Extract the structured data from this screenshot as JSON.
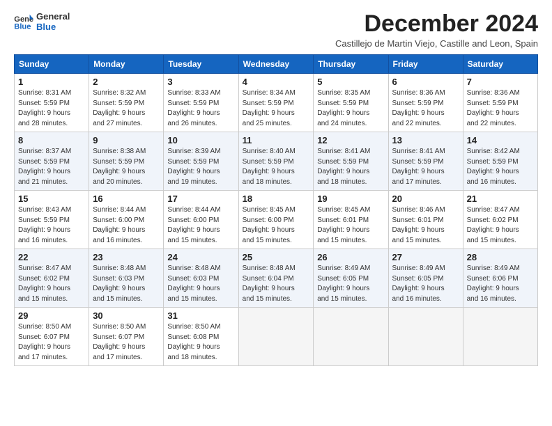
{
  "logo": {
    "line1": "General",
    "line2": "Blue"
  },
  "title": "December 2024",
  "subtitle": "Castillejo de Martin Viejo, Castille and Leon, Spain",
  "days_header": [
    "Sunday",
    "Monday",
    "Tuesday",
    "Wednesday",
    "Thursday",
    "Friday",
    "Saturday"
  ],
  "weeks": [
    [
      {
        "num": "1",
        "info": "Sunrise: 8:31 AM\nSunset: 5:59 PM\nDaylight: 9 hours\nand 28 minutes."
      },
      {
        "num": "2",
        "info": "Sunrise: 8:32 AM\nSunset: 5:59 PM\nDaylight: 9 hours\nand 27 minutes."
      },
      {
        "num": "3",
        "info": "Sunrise: 8:33 AM\nSunset: 5:59 PM\nDaylight: 9 hours\nand 26 minutes."
      },
      {
        "num": "4",
        "info": "Sunrise: 8:34 AM\nSunset: 5:59 PM\nDaylight: 9 hours\nand 25 minutes."
      },
      {
        "num": "5",
        "info": "Sunrise: 8:35 AM\nSunset: 5:59 PM\nDaylight: 9 hours\nand 24 minutes."
      },
      {
        "num": "6",
        "info": "Sunrise: 8:36 AM\nSunset: 5:59 PM\nDaylight: 9 hours\nand 22 minutes."
      },
      {
        "num": "7",
        "info": "Sunrise: 8:36 AM\nSunset: 5:59 PM\nDaylight: 9 hours\nand 22 minutes."
      }
    ],
    [
      {
        "num": "8",
        "info": "Sunrise: 8:37 AM\nSunset: 5:59 PM\nDaylight: 9 hours\nand 21 minutes."
      },
      {
        "num": "9",
        "info": "Sunrise: 8:38 AM\nSunset: 5:59 PM\nDaylight: 9 hours\nand 20 minutes."
      },
      {
        "num": "10",
        "info": "Sunrise: 8:39 AM\nSunset: 5:59 PM\nDaylight: 9 hours\nand 19 minutes."
      },
      {
        "num": "11",
        "info": "Sunrise: 8:40 AM\nSunset: 5:59 PM\nDaylight: 9 hours\nand 18 minutes."
      },
      {
        "num": "12",
        "info": "Sunrise: 8:41 AM\nSunset: 5:59 PM\nDaylight: 9 hours\nand 18 minutes."
      },
      {
        "num": "13",
        "info": "Sunrise: 8:41 AM\nSunset: 5:59 PM\nDaylight: 9 hours\nand 17 minutes."
      },
      {
        "num": "14",
        "info": "Sunrise: 8:42 AM\nSunset: 5:59 PM\nDaylight: 9 hours\nand 16 minutes."
      }
    ],
    [
      {
        "num": "15",
        "info": "Sunrise: 8:43 AM\nSunset: 5:59 PM\nDaylight: 9 hours\nand 16 minutes."
      },
      {
        "num": "16",
        "info": "Sunrise: 8:44 AM\nSunset: 6:00 PM\nDaylight: 9 hours\nand 16 minutes."
      },
      {
        "num": "17",
        "info": "Sunrise: 8:44 AM\nSunset: 6:00 PM\nDaylight: 9 hours\nand 15 minutes."
      },
      {
        "num": "18",
        "info": "Sunrise: 8:45 AM\nSunset: 6:00 PM\nDaylight: 9 hours\nand 15 minutes."
      },
      {
        "num": "19",
        "info": "Sunrise: 8:45 AM\nSunset: 6:01 PM\nDaylight: 9 hours\nand 15 minutes."
      },
      {
        "num": "20",
        "info": "Sunrise: 8:46 AM\nSunset: 6:01 PM\nDaylight: 9 hours\nand 15 minutes."
      },
      {
        "num": "21",
        "info": "Sunrise: 8:47 AM\nSunset: 6:02 PM\nDaylight: 9 hours\nand 15 minutes."
      }
    ],
    [
      {
        "num": "22",
        "info": "Sunrise: 8:47 AM\nSunset: 6:02 PM\nDaylight: 9 hours\nand 15 minutes."
      },
      {
        "num": "23",
        "info": "Sunrise: 8:48 AM\nSunset: 6:03 PM\nDaylight: 9 hours\nand 15 minutes."
      },
      {
        "num": "24",
        "info": "Sunrise: 8:48 AM\nSunset: 6:03 PM\nDaylight: 9 hours\nand 15 minutes."
      },
      {
        "num": "25",
        "info": "Sunrise: 8:48 AM\nSunset: 6:04 PM\nDaylight: 9 hours\nand 15 minutes."
      },
      {
        "num": "26",
        "info": "Sunrise: 8:49 AM\nSunset: 6:05 PM\nDaylight: 9 hours\nand 15 minutes."
      },
      {
        "num": "27",
        "info": "Sunrise: 8:49 AM\nSunset: 6:05 PM\nDaylight: 9 hours\nand 16 minutes."
      },
      {
        "num": "28",
        "info": "Sunrise: 8:49 AM\nSunset: 6:06 PM\nDaylight: 9 hours\nand 16 minutes."
      }
    ],
    [
      {
        "num": "29",
        "info": "Sunrise: 8:50 AM\nSunset: 6:07 PM\nDaylight: 9 hours\nand 17 minutes."
      },
      {
        "num": "30",
        "info": "Sunrise: 8:50 AM\nSunset: 6:07 PM\nDaylight: 9 hours\nand 17 minutes."
      },
      {
        "num": "31",
        "info": "Sunrise: 8:50 AM\nSunset: 6:08 PM\nDaylight: 9 hours\nand 18 minutes."
      },
      null,
      null,
      null,
      null
    ]
  ]
}
